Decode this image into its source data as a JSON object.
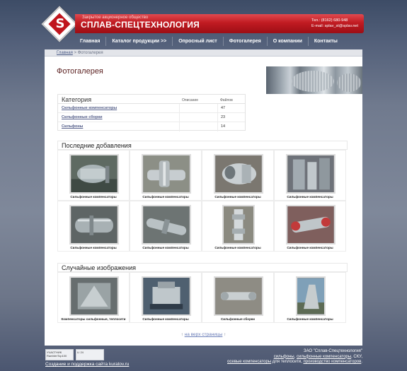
{
  "header": {
    "company_sub": "Закрытое акционерное общество",
    "company_name": "СПЛАВ-СПЕЦТЕХНОЛОГИЯ",
    "phone": "Тел.: (8162) 680-948",
    "email": "E-mail: splav_st@splav.net",
    "brand_color": "#c11b22"
  },
  "nav": {
    "items": [
      "Главная",
      "Каталог продукции >>",
      "Опросный лист",
      "Фотогалерея",
      "О компании",
      "Контакты"
    ]
  },
  "breadcrumb": {
    "home": "Главная",
    "sep": " > ",
    "current": "Фотогалерея"
  },
  "page": {
    "title": "Фотогалерея"
  },
  "categories": {
    "title": "Категория",
    "col_desc": "Описание",
    "col_files": "Файлов",
    "rows": [
      {
        "name": "Сильфонные компенсаторы",
        "count": "47"
      },
      {
        "name": "Сильфонные сборки",
        "count": "23"
      },
      {
        "name": "Сильфоны",
        "count": "14"
      }
    ]
  },
  "latest": {
    "title": "Последние добавления",
    "items": [
      "Сильфонные компенсаторы",
      "Сильфонные компенсаторы",
      "Сильфонные компенсаторы",
      "Сильфонные компенсаторы",
      "Сильфонные компенсаторы",
      "Сильфонные компенсаторы",
      "Сильфонные компенсаторы",
      "Сильфонные компенсаторы"
    ]
  },
  "random": {
    "title": "Случайные изображения",
    "items": [
      "Компенсаторы сильфонные, теплосети",
      "Сильфонные компенсаторы",
      "Сильфонные сборки",
      "Сильфонные компенсаторы"
    ]
  },
  "totop": {
    "arrow_left": "↑",
    "label": "на верх страницы",
    "arrow_right": "↑"
  },
  "footer": {
    "badge1": "УЧАСТНИК RamblerTop100",
    "badge2": "LI 24",
    "creator": "Создание и поддержка сайта kuratov.ru",
    "company": "ЗАО \"Сплав-Спецтехнология\"",
    "line2_a": "сильфоны",
    "line2_b": "сильфонные компенсаторы",
    "line2_c": ", СКУ,",
    "line3_a": "осевые компенсаторы",
    "line3_b": " для теплосети, ",
    "line3_c": "производство компенсаторов",
    "line3_d": "."
  }
}
